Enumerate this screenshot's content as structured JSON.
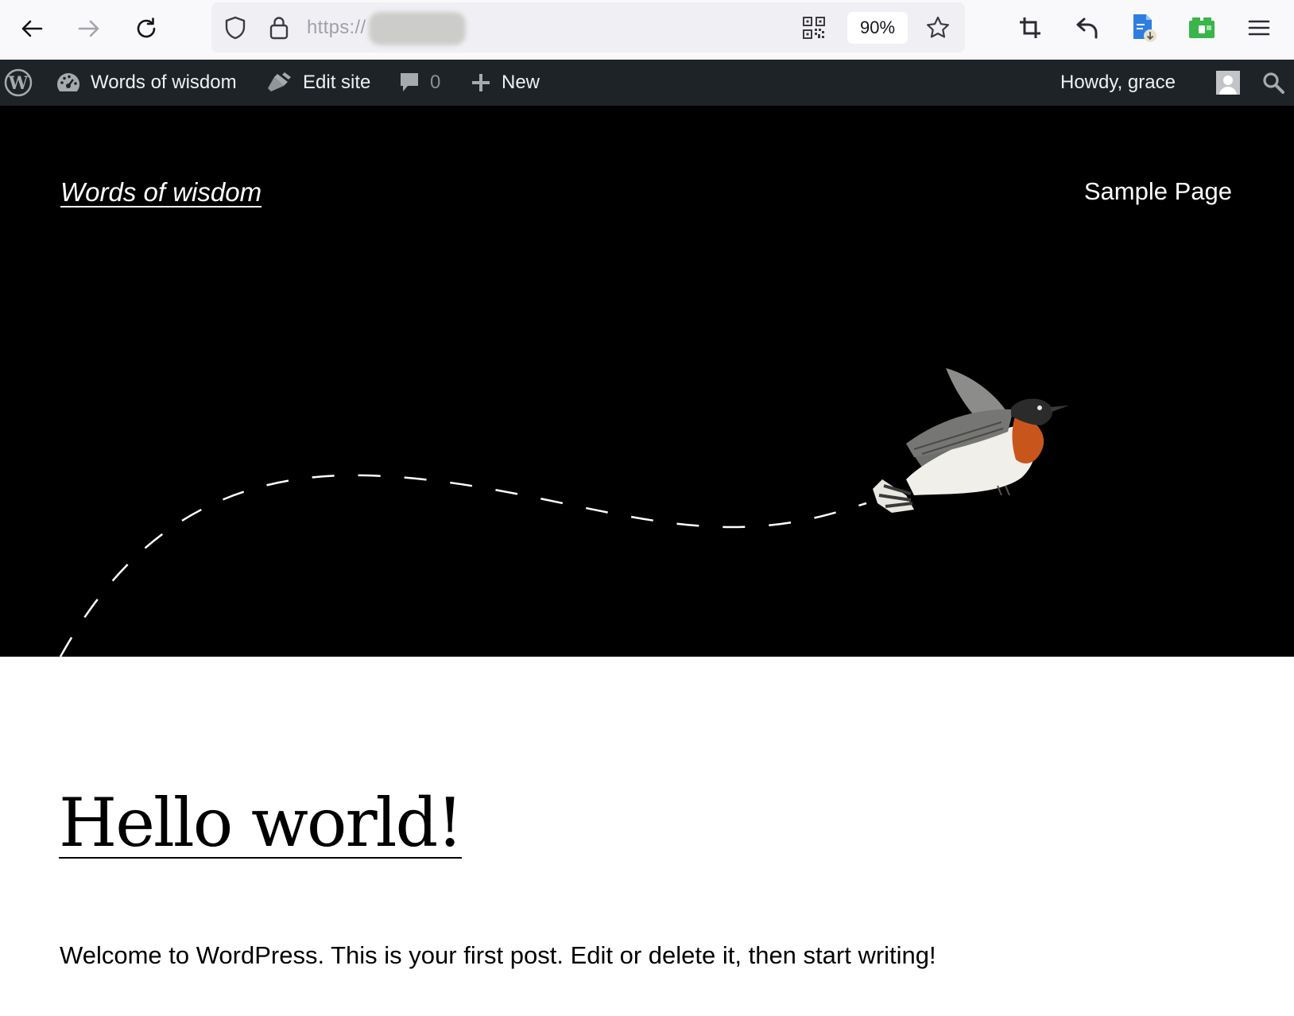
{
  "browser": {
    "url_prefix": "https://",
    "zoom": "90%",
    "icons": {
      "back": "arrow-left-icon",
      "forward": "arrow-right-icon",
      "reload": "reload-icon",
      "shield": "shield-icon",
      "lock": "lock-icon",
      "qr": "qr-code-icon",
      "bookmark": "star-icon",
      "crop": "crop-icon",
      "undo": "undo-icon",
      "doc_download": "document-download-icon",
      "extension": "green-extension-icon",
      "menu": "hamburger-menu-icon"
    }
  },
  "adminbar": {
    "site_name": "Words of wisdom",
    "edit_site": "Edit site",
    "comments_count": "0",
    "new_label": "New",
    "greeting": "Howdy, grace"
  },
  "header": {
    "site_title": "Words of wisdom",
    "nav_item": "Sample Page"
  },
  "post": {
    "title": "Hello world!",
    "body": "Welcome to WordPress. This is your first post. Edit or delete it, then start writing!"
  },
  "colors": {
    "adminbar_bg": "#1d2327",
    "header_bg": "#000000",
    "bird_orange": "#c8561c"
  }
}
